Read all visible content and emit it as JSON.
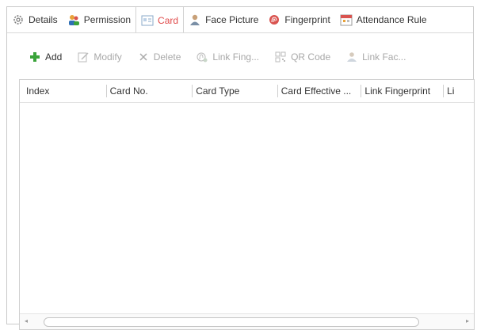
{
  "tabs": [
    {
      "label": "Details",
      "icon": "gear-icon",
      "active": false
    },
    {
      "label": "Permission",
      "icon": "users-icon",
      "active": false
    },
    {
      "label": "Card",
      "icon": "card-icon",
      "active": true
    },
    {
      "label": "Face Picture",
      "icon": "person-icon",
      "active": false
    },
    {
      "label": "Fingerprint",
      "icon": "fingerprint-icon",
      "active": false
    },
    {
      "label": "Attendance Rule",
      "icon": "calendar-icon",
      "active": false
    }
  ],
  "toolbar": {
    "add": "Add",
    "modify": "Modify",
    "delete": "Delete",
    "link_fingerprint": "Link Fing...",
    "qr_code": "QR Code",
    "link_face": "Link Fac..."
  },
  "table": {
    "columns": [
      "Index",
      "Card No.",
      "Card Type",
      "Card Effective ...",
      "Link Fingerprint",
      "Li"
    ],
    "rows": []
  },
  "colors": {
    "active_tab": "#e04a4a",
    "add_icon": "#3aa33a",
    "disabled_text": "#a8a8a8"
  }
}
